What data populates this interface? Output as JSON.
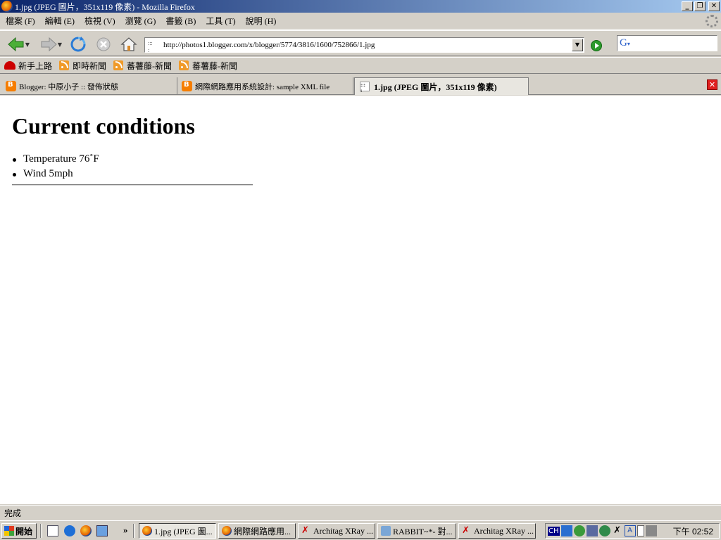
{
  "window": {
    "title": "1.jpg (JPEG 圖片，351x119 像素) - Mozilla Firefox"
  },
  "menu": {
    "items": [
      "檔案 (F)",
      "編輯 (E)",
      "檢視 (V)",
      "瀏覽 (G)",
      "書籤 (B)",
      "工具 (T)",
      "說明 (H)"
    ]
  },
  "navbar": {
    "url": "http://photos1.blogger.com/x/blogger/5774/3816/1600/752866/1.jpg",
    "search_value": ""
  },
  "bookmarks": {
    "items": [
      "新手上路",
      "即時新聞",
      "蕃薯藤-新聞",
      "蕃薯藤-新聞"
    ]
  },
  "tabs": {
    "items": [
      "Blogger: 中原小子 :: 發佈狀態",
      "網際網路應用系統設計: sample XML file",
      "1.jpg (JPEG 圖片，351x119 像素)"
    ],
    "active_index": 2
  },
  "content": {
    "heading": "Current conditions",
    "items": [
      "Temperature 76˚F",
      "Wind 5mph"
    ]
  },
  "status": {
    "text": "完成"
  },
  "taskbar": {
    "start_label": "開始",
    "overflow_label": "»",
    "buttons": [
      "1.jpg (JPEG 圖...",
      "網際網路應用...",
      "Architag XRay ...",
      "RABBIT~*- 對...",
      "Architag XRay ..."
    ],
    "tray_ime": "CH",
    "clock": "下午 02:52"
  },
  "colors": {
    "titlebar_start": "#0a246a",
    "titlebar_end": "#a6caf0",
    "chrome": "#d4d0c8",
    "rss": "#f09a28",
    "blogger": "#f57d00"
  }
}
